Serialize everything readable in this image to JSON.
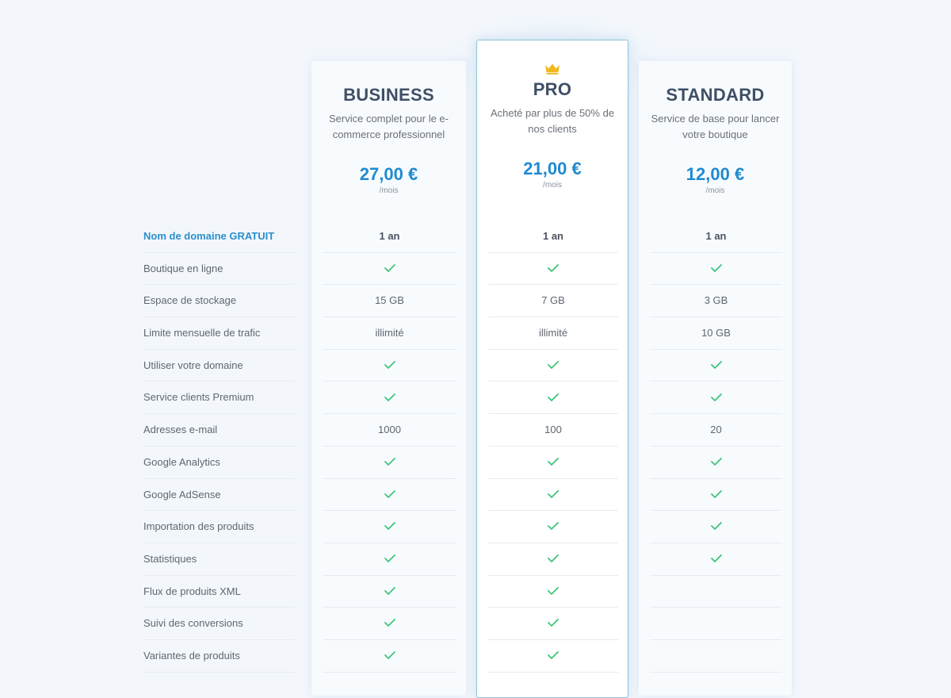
{
  "colors": {
    "accent_blue": "#1f8ad0",
    "title_dark": "#3e4f66",
    "check_green": "#3ec57c",
    "crown_gold": "#f2b71c",
    "pro_border": "#8fc3d8"
  },
  "features": [
    "Nom de domaine GRATUIT",
    "Boutique en ligne",
    "Espace de stockage",
    "Limite mensuelle de trafic",
    "Utiliser votre domaine",
    "Service clients Premium",
    "Adresses e-mail",
    "Google Analytics",
    "Google AdSense",
    "Importation des produits",
    "Statistiques",
    "Flux de produits XML",
    "Suivi des conversions",
    "Variantes de produits"
  ],
  "plans": [
    {
      "id": "business",
      "name": "BUSINESS",
      "description": "Service complet pour le e-commerce professionnel",
      "price": "27,00 €",
      "period": "/mois",
      "featured": false,
      "values": [
        "1 an",
        "check",
        "15 GB",
        "illimité",
        "check",
        "check",
        "1000",
        "check",
        "check",
        "check",
        "check",
        "check",
        "check",
        "check"
      ]
    },
    {
      "id": "pro",
      "name": "PRO",
      "icon": "crown-icon",
      "description": "Acheté par plus de 50% de nos clients",
      "price": "21,00 €",
      "period": "/mois",
      "featured": true,
      "values": [
        "1 an",
        "check",
        "7 GB",
        "illimité",
        "check",
        "check",
        "100",
        "check",
        "check",
        "check",
        "check",
        "check",
        "check",
        "check"
      ]
    },
    {
      "id": "standard",
      "name": "STANDARD",
      "description": "Service de base pour lancer votre boutique",
      "price": "12,00 €",
      "period": "/mois",
      "featured": false,
      "values": [
        "1 an",
        "check",
        "3 GB",
        "10 GB",
        "check",
        "check",
        "20",
        "check",
        "check",
        "check",
        "check",
        "",
        "",
        ""
      ]
    }
  ]
}
